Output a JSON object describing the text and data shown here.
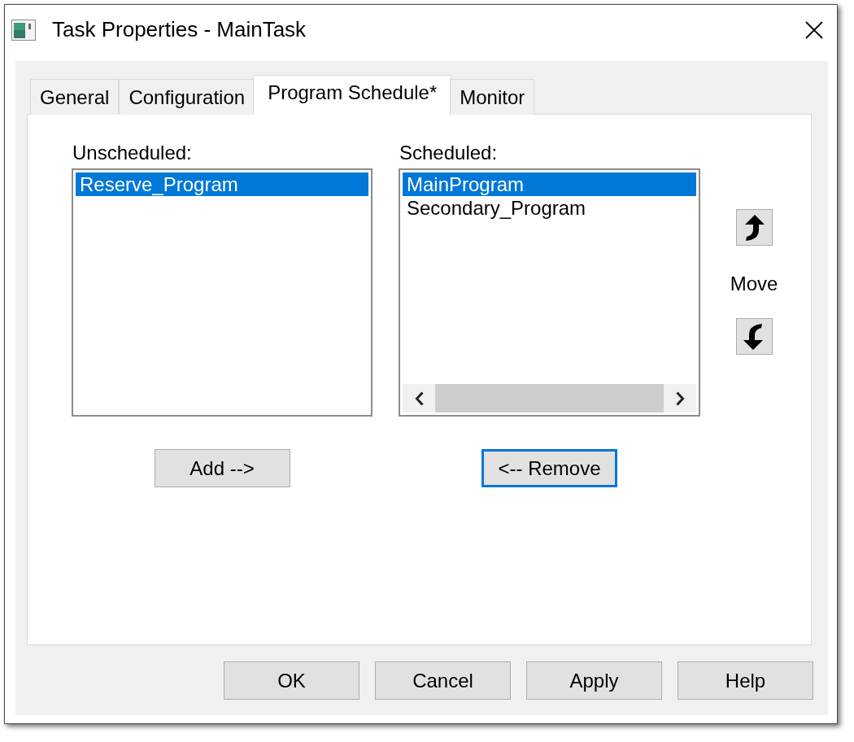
{
  "window": {
    "title": "Task Properties - MainTask"
  },
  "tabs": [
    {
      "label": "General",
      "selected": false
    },
    {
      "label": "Configuration",
      "selected": false
    },
    {
      "label": "Program Schedule*",
      "selected": true
    },
    {
      "label": "Monitor",
      "selected": false
    }
  ],
  "lists": [
    {
      "label": "Unscheduled:",
      "items": [
        {
          "label": "Reserve_Program",
          "selected": true
        }
      ],
      "horizontal_scrollbar": false,
      "button": {
        "label": "Add -->",
        "focused": false
      }
    },
    {
      "label": "Scheduled:",
      "items": [
        {
          "label": "MainProgram",
          "selected": true
        },
        {
          "label": "Secondary_Program",
          "selected": false
        }
      ],
      "horizontal_scrollbar": true,
      "button": {
        "label": "<-- Remove",
        "focused": true
      }
    }
  ],
  "move": {
    "label": "Move"
  },
  "buttons": [
    "OK",
    "Cancel",
    "Apply",
    "Help"
  ]
}
